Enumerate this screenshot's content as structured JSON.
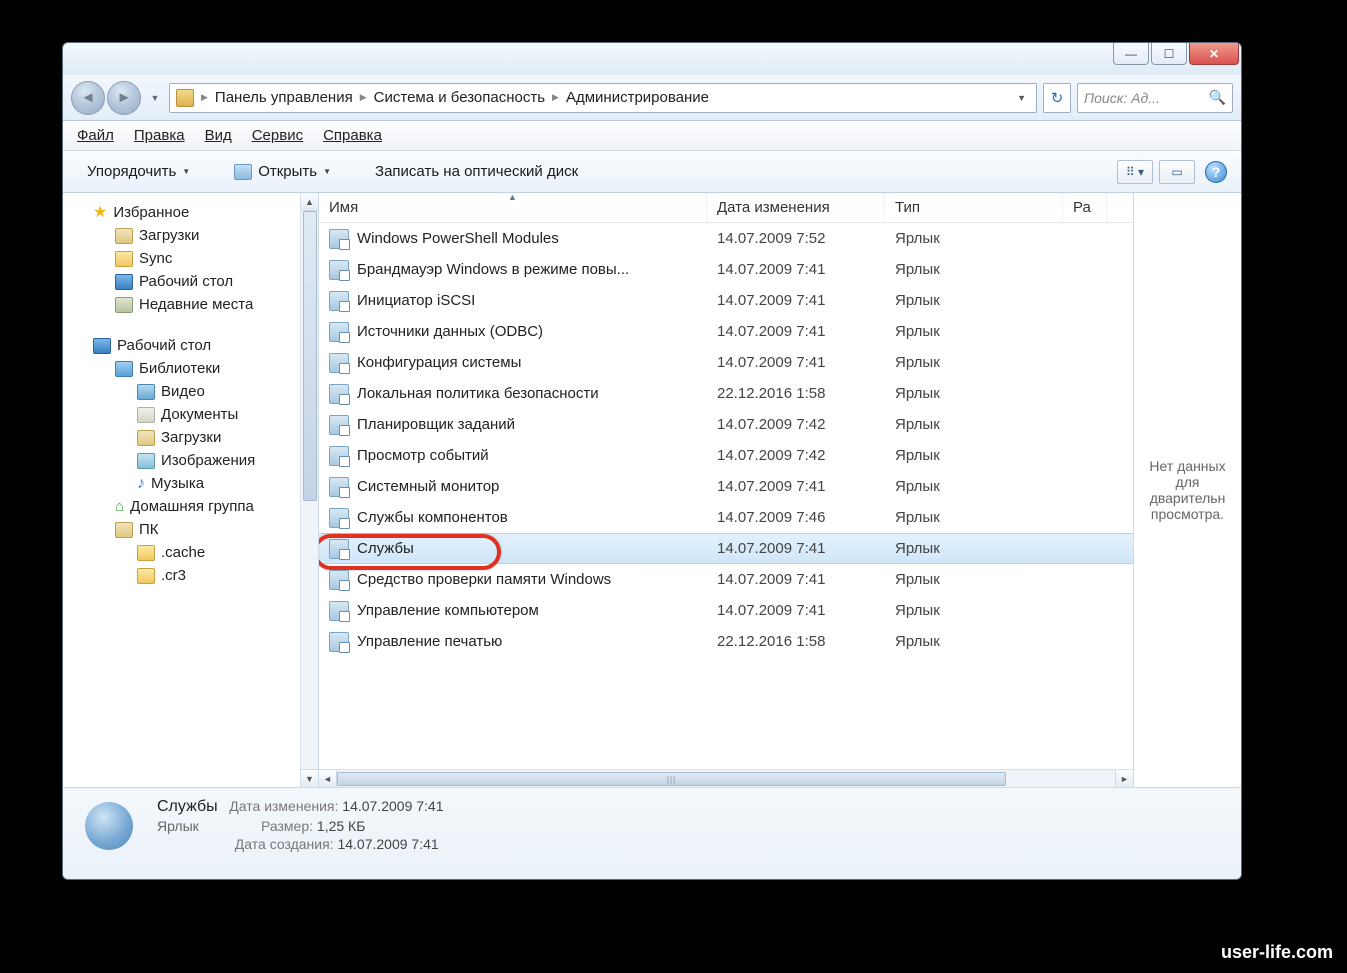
{
  "titlebar": {
    "min": "—",
    "max": "☐",
    "close": "✕"
  },
  "breadcrumb": {
    "seg1": "Панель управления",
    "seg2": "Система и безопасность",
    "seg3": "Администрирование"
  },
  "search": {
    "placeholder": "Поиск: Ад..."
  },
  "menu": {
    "file": "Файл",
    "edit": "Правка",
    "view": "Вид",
    "tools": "Сервис",
    "help": "Справка"
  },
  "toolbar": {
    "organize": "Упорядочить",
    "open": "Открыть",
    "burn": "Записать на оптический диск"
  },
  "columns": {
    "name": "Имя",
    "date": "Дата изменения",
    "type": "Тип",
    "size": "Ра"
  },
  "preview_text": "Нет данных для дварительн просмотра.",
  "sidebar": {
    "favorites": "Избранное",
    "downloads": "Загрузки",
    "sync": "Sync",
    "desktop_fav": "Рабочий стол",
    "recent": "Недавние места",
    "desktop": "Рабочий стол",
    "libraries": "Библиотеки",
    "video": "Видео",
    "documents": "Документы",
    "downloads2": "Загрузки",
    "images": "Изображения",
    "music": "Музыка",
    "homegroup": "Домашняя группа",
    "pc": "ПК",
    "cache": ".cache",
    "cr3": ".cr3"
  },
  "files": [
    {
      "name": "Windows PowerShell Modules",
      "date": "14.07.2009 7:52",
      "type": "Ярлык"
    },
    {
      "name": "Брандмауэр Windows в режиме повы...",
      "date": "14.07.2009 7:41",
      "type": "Ярлык"
    },
    {
      "name": "Инициатор iSCSI",
      "date": "14.07.2009 7:41",
      "type": "Ярлык"
    },
    {
      "name": "Источники данных (ODBC)",
      "date": "14.07.2009 7:41",
      "type": "Ярлык"
    },
    {
      "name": "Конфигурация системы",
      "date": "14.07.2009 7:41",
      "type": "Ярлык"
    },
    {
      "name": "Локальная политика безопасности",
      "date": "22.12.2016 1:58",
      "type": "Ярлык"
    },
    {
      "name": "Планировщик заданий",
      "date": "14.07.2009 7:42",
      "type": "Ярлык"
    },
    {
      "name": "Просмотр событий",
      "date": "14.07.2009 7:42",
      "type": "Ярлык"
    },
    {
      "name": "Системный монитор",
      "date": "14.07.2009 7:41",
      "type": "Ярлык"
    },
    {
      "name": "Службы компонентов",
      "date": "14.07.2009 7:46",
      "type": "Ярлык"
    },
    {
      "name": "Службы",
      "date": "14.07.2009 7:41",
      "type": "Ярлык"
    },
    {
      "name": "Средство проверки памяти Windows",
      "date": "14.07.2009 7:41",
      "type": "Ярлык"
    },
    {
      "name": "Управление компьютером",
      "date": "14.07.2009 7:41",
      "type": "Ярлык"
    },
    {
      "name": "Управление печатью",
      "date": "22.12.2016 1:58",
      "type": "Ярлык"
    }
  ],
  "details": {
    "title": "Службы",
    "subtitle": "Ярлык",
    "date_label": "Дата изменения:",
    "date_value": "14.07.2009 7:41",
    "size_label": "Размер:",
    "size_value": "1,25 КБ",
    "created_label": "Дата создания:",
    "created_value": "14.07.2009 7:41"
  },
  "watermark": "user-life.com"
}
